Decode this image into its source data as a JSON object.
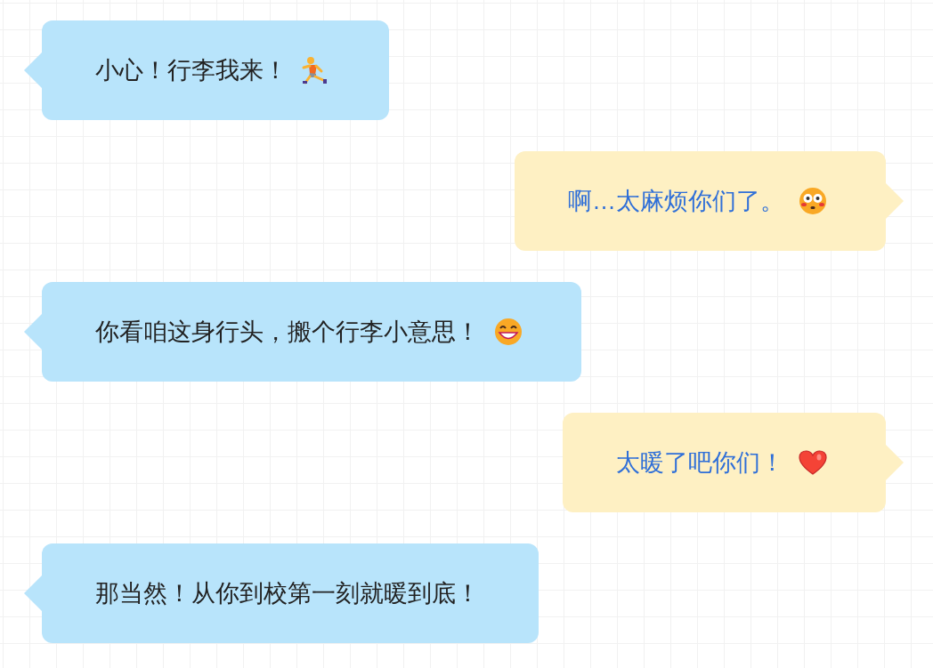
{
  "messages": [
    {
      "kind": "received",
      "text": "小心！行李我来！",
      "emoji": {
        "kind": "runner"
      }
    },
    {
      "kind": "sent",
      "text": "啊…太麻烦你们了。",
      "emoji": {
        "kind": "flushed"
      }
    },
    {
      "kind": "received",
      "text": "你看咱这身行头，搬个行李小意思！",
      "emoji": {
        "kind": "grin"
      }
    },
    {
      "kind": "sent",
      "text": "太暖了吧你们！",
      "emoji": {
        "kind": "heart"
      }
    },
    {
      "kind": "received",
      "text": "那当然！从你到校第一刻就暖到底！"
    }
  ]
}
